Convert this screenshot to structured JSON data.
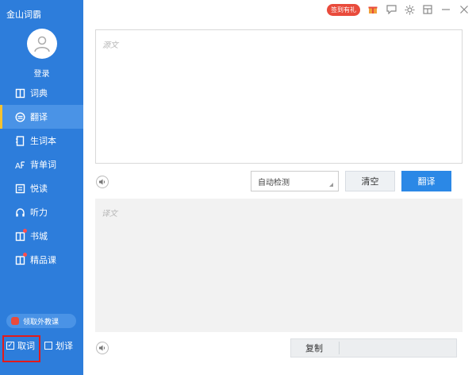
{
  "app": {
    "title": "金山词霸"
  },
  "account": {
    "login_label": "登录"
  },
  "sidebar": {
    "items": [
      {
        "label": "词典",
        "icon": "book-icon"
      },
      {
        "label": "翻译",
        "icon": "translate-icon",
        "active": true
      },
      {
        "label": "生词本",
        "icon": "notebook-icon"
      },
      {
        "label": "背单词",
        "icon": "word-memorize-icon"
      },
      {
        "label": "悦读",
        "icon": "reading-icon"
      },
      {
        "label": "听力",
        "icon": "headphones-icon"
      },
      {
        "label": "书城",
        "icon": "bookstore-icon",
        "dot": true
      },
      {
        "label": "精品课",
        "icon": "course-icon",
        "dot": true
      }
    ],
    "promo_label": "领取外教课",
    "check_fetch_word": {
      "label": "取词",
      "checked": true
    },
    "check_select_translate": {
      "label": "划译",
      "checked": false
    }
  },
  "topbar": {
    "badge_label": "签到有礼",
    "icons": [
      "gift-icon",
      "chat-icon",
      "settings-icon",
      "mini-mode-icon",
      "minimize-icon",
      "close-icon"
    ]
  },
  "translator": {
    "source_placeholder": "源文",
    "language_select": "自动检测",
    "clear_label": "清空",
    "translate_label": "翻译",
    "result_placeholder": "译文",
    "copy_label": "复制"
  },
  "colors": {
    "sidebar": "#2d7ddb",
    "accent": "#2b88e6",
    "active_marker": "#f5c230",
    "badge": "#e94b3c",
    "highlight_frame": "#e31b1b"
  }
}
